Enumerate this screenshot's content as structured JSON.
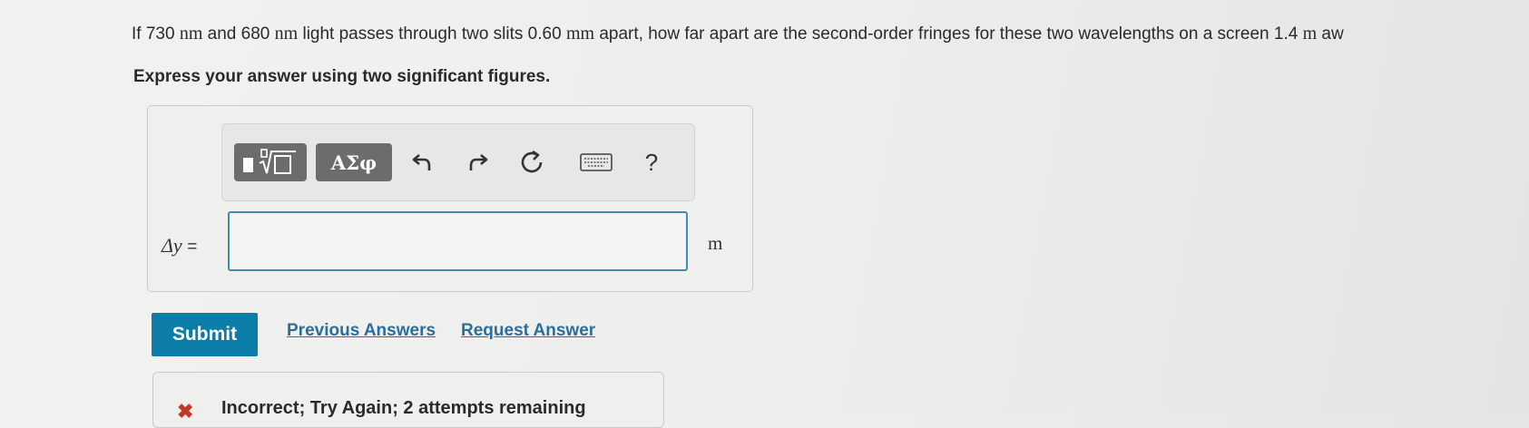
{
  "question": {
    "p1": "If ",
    "w1_value": "730",
    "w1_unit": "nm",
    "p2": " and ",
    "w2_value": "680",
    "w2_unit": "nm",
    "p3": " light passes through two slits ",
    "d_value": "0.60",
    "d_unit": "mm",
    "p4": " apart, how far apart are the second-order fringes for these two wavelengths on a screen ",
    "L_value": "1.4",
    "L_unit": "m",
    "p5": " aw"
  },
  "instruction": "Express your answer using two significant figures.",
  "toolbar": {
    "greek_label": "ΑΣφ",
    "help_label": "?",
    "icons": [
      "template-icon",
      "undo-icon",
      "redo-icon",
      "reset-icon",
      "keyboard-icon",
      "help-icon"
    ]
  },
  "answer": {
    "variable": "Δy",
    "equals": "=",
    "value": "",
    "unit": "m"
  },
  "actions": {
    "submit_label": "Submit",
    "previous_answers_label": "Previous Answers",
    "request_answer_label": "Request Answer"
  },
  "feedback": {
    "icon": "x-icon",
    "text": "Incorrect; Try Again; 2 attempts remaining"
  },
  "colors": {
    "submit_bg": "#0c7ca8",
    "input_border": "#3d8db0",
    "link": "#2a6e9c",
    "error": "#c0392b"
  }
}
